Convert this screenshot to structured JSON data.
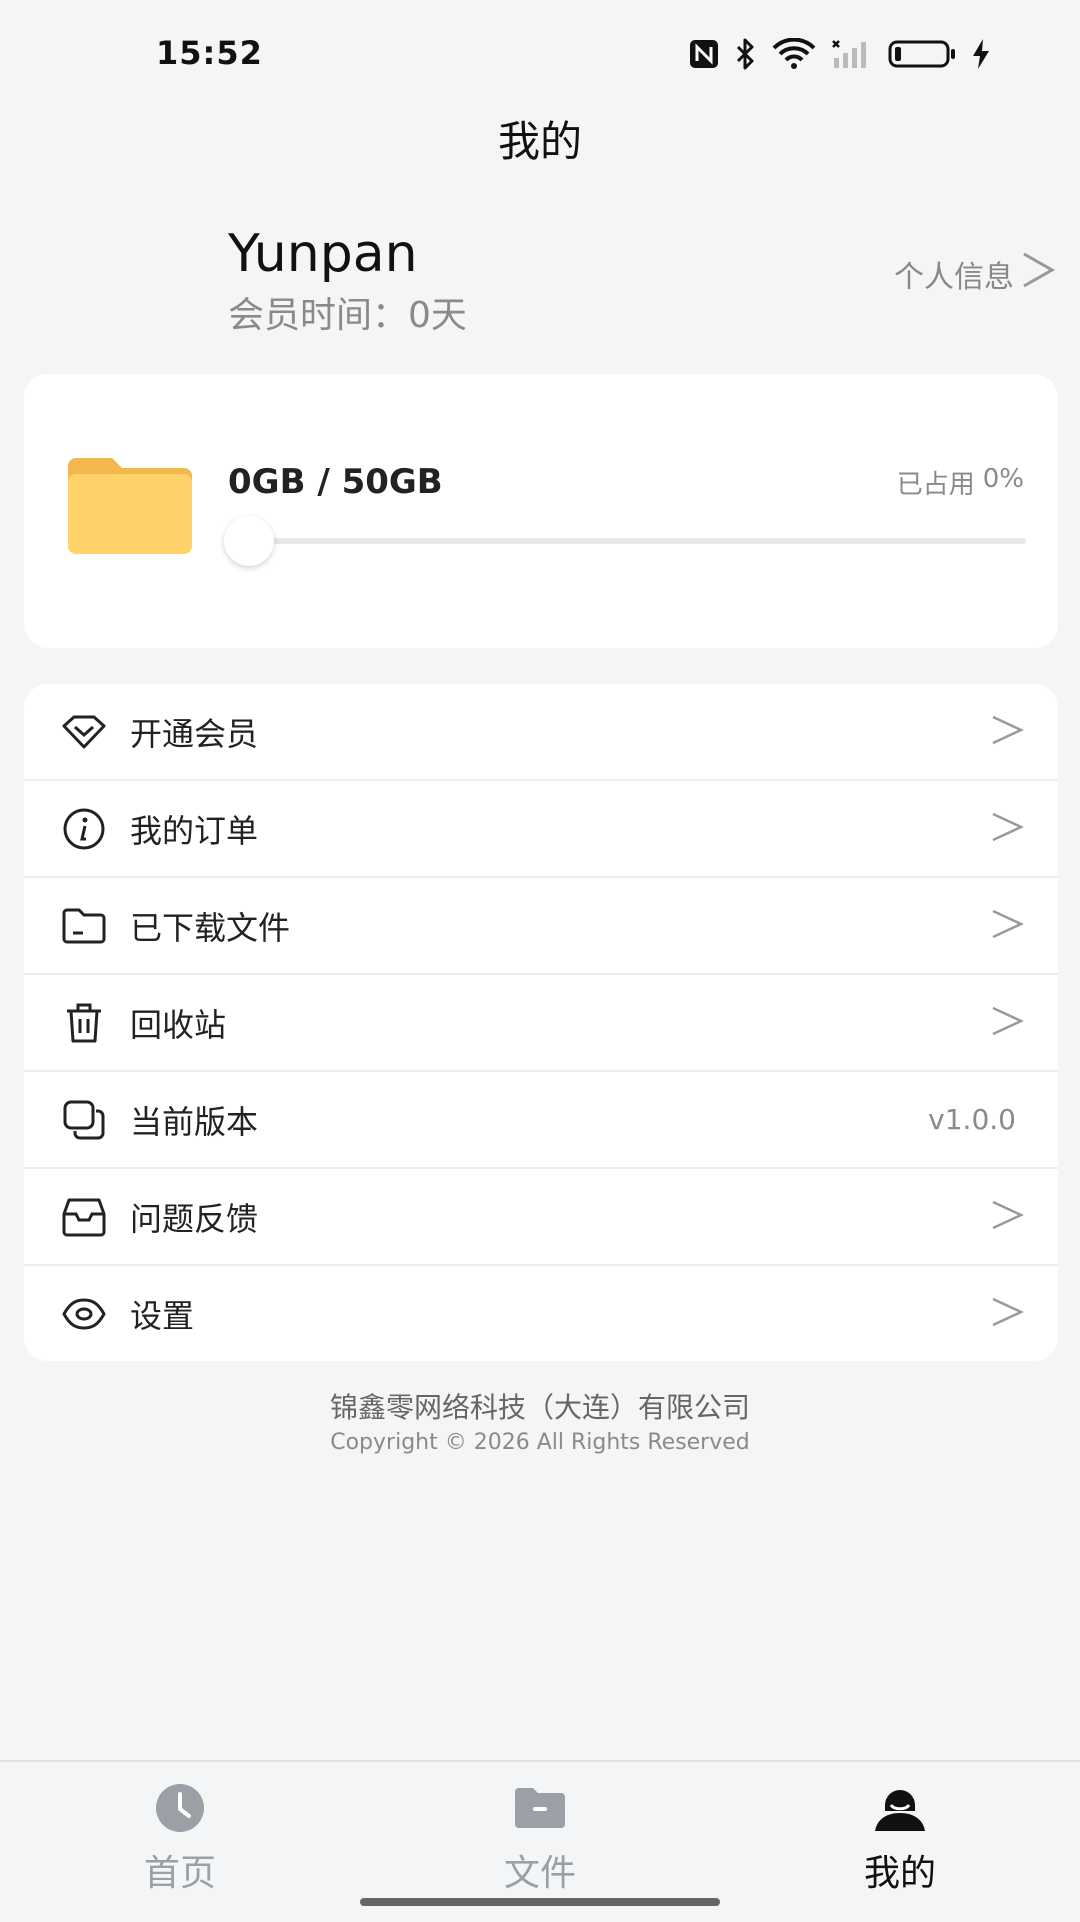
{
  "status_bar": {
    "time": "15:52",
    "icons": [
      "nfc-icon",
      "bluetooth-icon",
      "wifi-icon",
      "signal-icon",
      "battery-icon",
      "charging-icon"
    ]
  },
  "header": {
    "title": "我的"
  },
  "profile": {
    "name": "Yunpan",
    "member_label": "会员时间：",
    "member_value": "0天",
    "link_label": "个人信息",
    "link_icon": ">"
  },
  "storage": {
    "text": "0GB / 50GB",
    "used_label": "已占用",
    "used_percent": "0%",
    "progress": 0,
    "icon": "folder-icon",
    "colors": {
      "folder": "#FFD26A",
      "folder_tab": "#F2B84B"
    }
  },
  "menu": [
    {
      "id": "vip",
      "label": "开通会员",
      "icon": "diamond-icon",
      "chevron": ">"
    },
    {
      "id": "orders",
      "label": "我的订单",
      "icon": "info-icon",
      "chevron": ">"
    },
    {
      "id": "downloads",
      "label": "已下载文件",
      "icon": "folder-outline-icon",
      "chevron": ">"
    },
    {
      "id": "trash",
      "label": "回收站",
      "icon": "trash-icon",
      "chevron": ">"
    },
    {
      "id": "version",
      "label": "当前版本",
      "icon": "copy-icon",
      "value": "v1.0.0"
    },
    {
      "id": "feedback",
      "label": "问题反馈",
      "icon": "inbox-icon",
      "chevron": ">"
    },
    {
      "id": "settings",
      "label": "设置",
      "icon": "eye-icon",
      "chevron": ">"
    }
  ],
  "footer": {
    "company": "锦鑫零网络科技（大连）有限公司",
    "copyright": "Copyright © 2026 All Rights Reserved"
  },
  "bottom_nav": [
    {
      "label": "首页",
      "icon": "clock-icon",
      "active": false
    },
    {
      "label": "文件",
      "icon": "folder-icon",
      "active": false
    },
    {
      "label": "我的",
      "icon": "user-icon",
      "active": true
    }
  ],
  "colors": {
    "active": "#111111",
    "inactive": "#9AA0A6",
    "background": "#F4F5F7"
  }
}
